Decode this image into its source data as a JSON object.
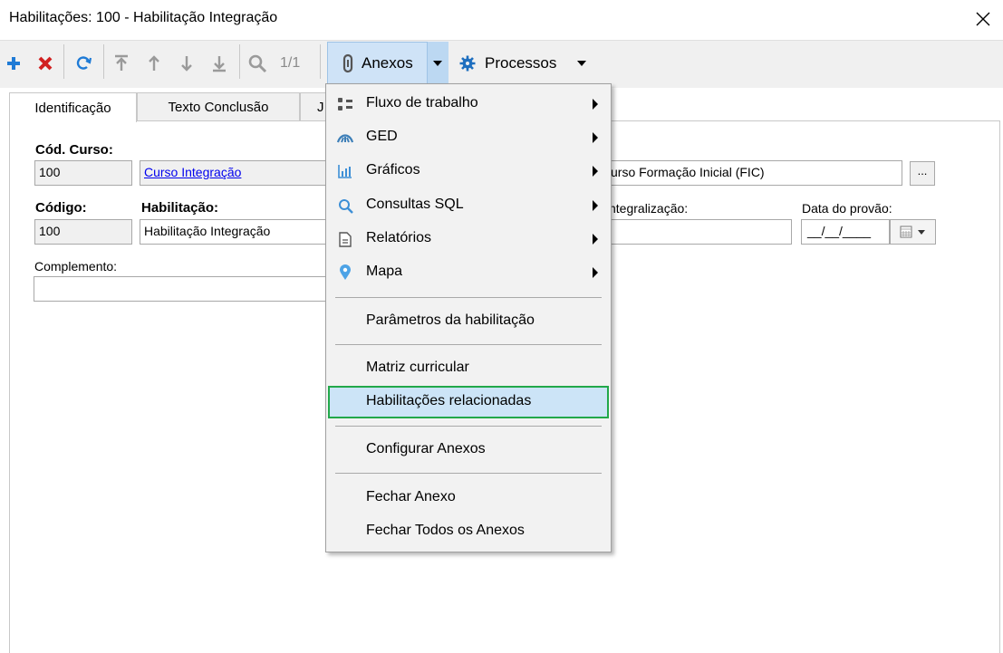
{
  "window": {
    "title": "Habilitações: 100 - Habilitação Integração"
  },
  "toolbar": {
    "record_counter": "1/1",
    "anexos_label": "Anexos",
    "processos_label": "Processos",
    "colors": {
      "add": "#1f7bd6",
      "delete": "#d11f1f",
      "refresh": "#1f7bd6",
      "nav": "#9a9a9a"
    }
  },
  "tabs": [
    {
      "label": "Identificação"
    },
    {
      "label": "Texto Conclusão"
    },
    {
      "label": "J"
    }
  ],
  "form": {
    "cod_curso_label": "Cód. Curso:",
    "cod_curso_value": "100",
    "curso_link": "Curso Integração",
    "curso_tipo_value": "urso Formação Inicial (FIC)",
    "browse_label": "...",
    "codigo_label": "Código:",
    "codigo_value": "100",
    "habilitacao_label": "Habilitação:",
    "habilitacao_value": "Habilitação Integração",
    "integralizacao_label": "ntegralização:",
    "data_provao_label": "Data do provão:",
    "data_provao_value": "__/__/____",
    "complemento_label": "Complemento:"
  },
  "menu": {
    "items": [
      {
        "label": "Fluxo de trabalho",
        "icon": "workflow-icon"
      },
      {
        "label": "GED",
        "icon": "ged-icon"
      },
      {
        "label": "Gráficos",
        "icon": "chart-icon"
      },
      {
        "label": "Consultas SQL",
        "icon": "search-icon"
      },
      {
        "label": "Relatórios",
        "icon": "report-icon"
      },
      {
        "label": "Mapa",
        "icon": "map-pin-icon"
      },
      {
        "label": "Parâmetros da habilitação"
      },
      {
        "label": "Matriz curricular"
      },
      {
        "label": "Habilitações relacionadas"
      },
      {
        "label": "Configurar Anexos"
      },
      {
        "label": "Fechar Anexo"
      },
      {
        "label": "Fechar Todos os Anexos"
      }
    ],
    "highlight_color": "#22a84a"
  }
}
